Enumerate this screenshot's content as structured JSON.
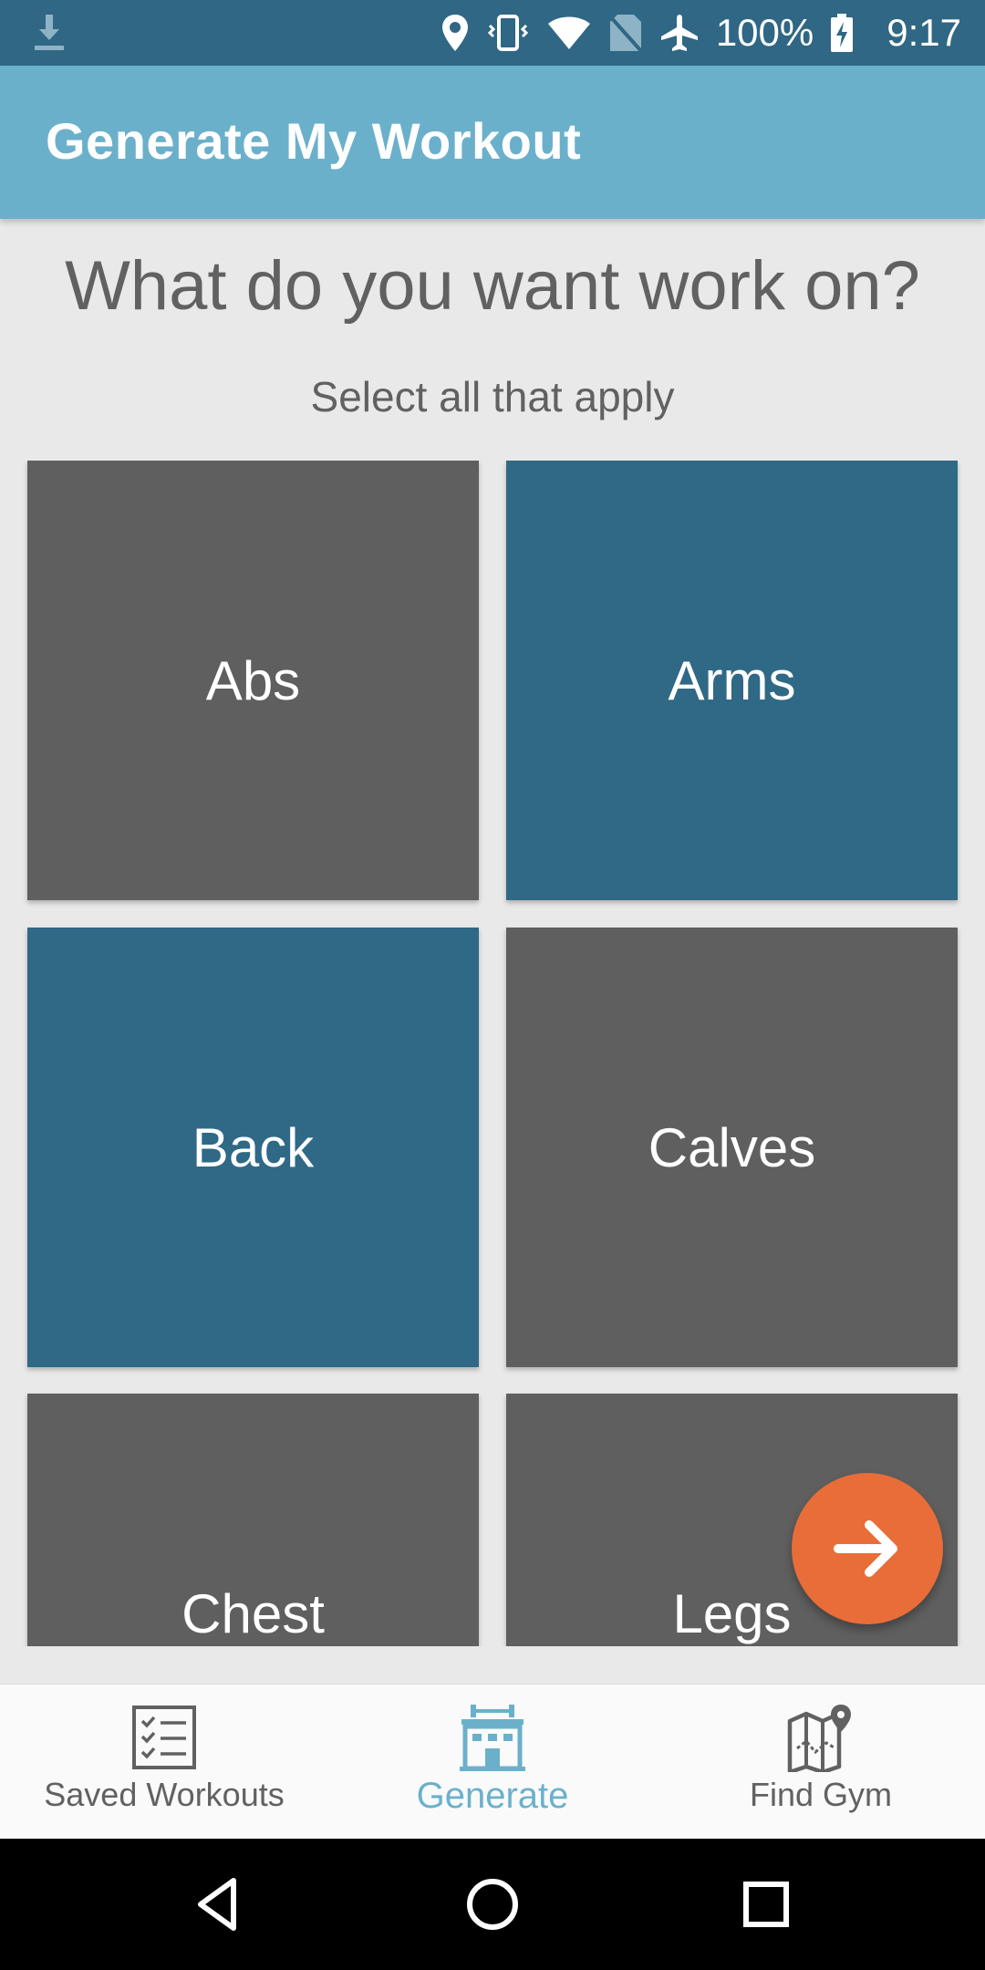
{
  "status_bar": {
    "battery": "100%",
    "time": "9:17",
    "icons": [
      "download-icon",
      "location-icon",
      "vibrate-icon",
      "wifi-icon",
      "no-sim-icon",
      "airplane-mode-icon",
      "battery-charging-icon"
    ]
  },
  "app_bar": {
    "title": "Generate My Workout"
  },
  "main": {
    "heading": "What do you want work on?",
    "subheading": "Select all that apply",
    "tiles": [
      {
        "label": "Abs",
        "selected": false
      },
      {
        "label": "Arms",
        "selected": true
      },
      {
        "label": "Back",
        "selected": true
      },
      {
        "label": "Calves",
        "selected": false
      },
      {
        "label": "Chest",
        "selected": false
      },
      {
        "label": "Legs",
        "selected": false
      }
    ],
    "fab_icon": "arrow-right-icon"
  },
  "bottom_nav": {
    "items": [
      {
        "label": "Saved Workouts",
        "icon": "checklist-icon",
        "active": false
      },
      {
        "label": "Generate",
        "icon": "gym-building-icon",
        "active": true
      },
      {
        "label": "Find Gym",
        "icon": "map-pin-icon",
        "active": false
      }
    ]
  },
  "colors": {
    "status_bar": "#2f6784",
    "app_bar": "#6bb0cb",
    "tile_default": "#5f5f5f",
    "tile_selected": "#2f6986",
    "fab": "#e86d38",
    "nav_active": "#6bb0cb",
    "text_muted": "#616161"
  }
}
